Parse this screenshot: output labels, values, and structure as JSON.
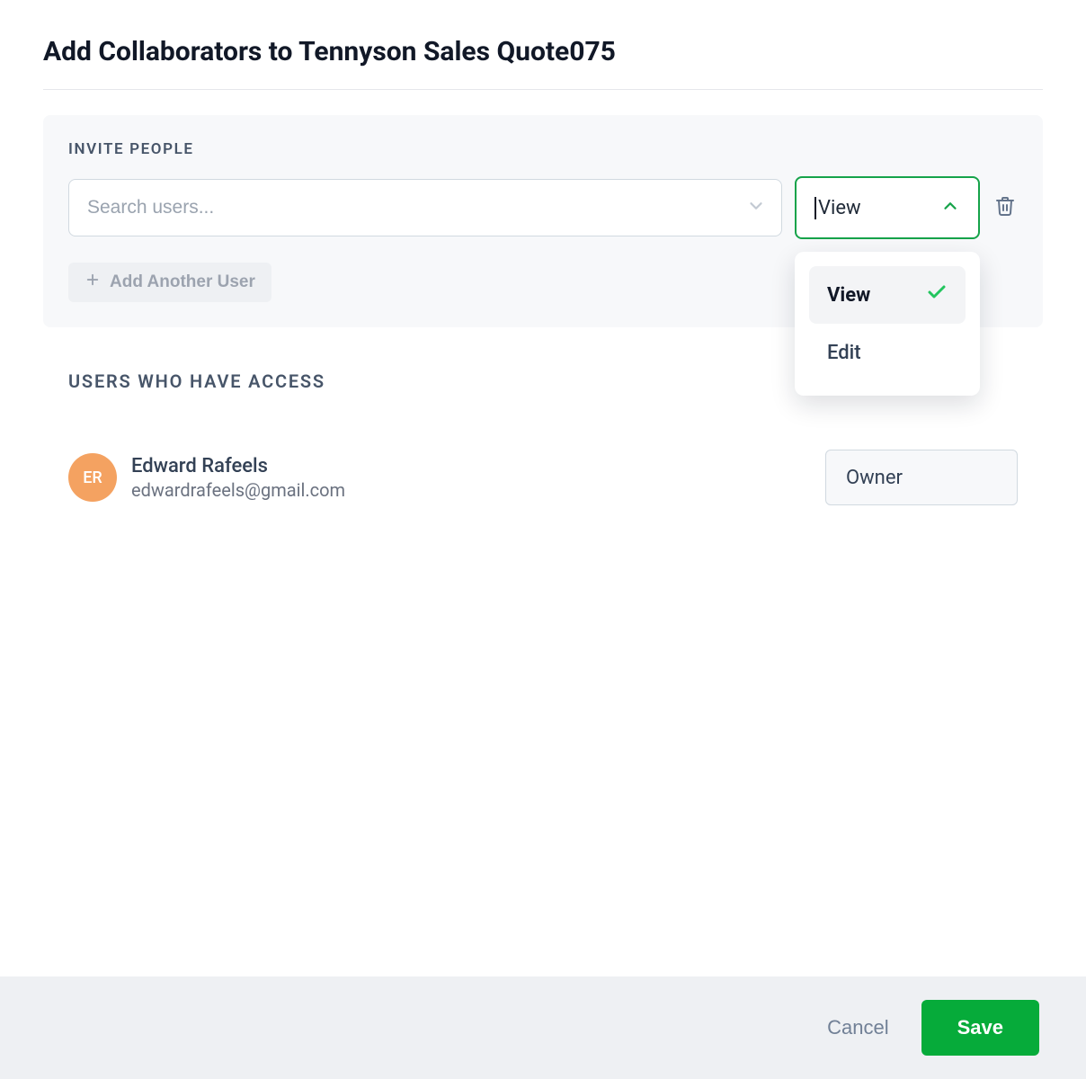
{
  "header": {
    "title": "Add Collaborators to Tennyson Sales Quote075"
  },
  "invite": {
    "section_label": "INVITE PEOPLE",
    "search_placeholder": "Search users...",
    "permission_selected": "View",
    "permission_options": [
      {
        "label": "View",
        "selected": true
      },
      {
        "label": "Edit",
        "selected": false
      }
    ],
    "add_another_label": "Add Another User"
  },
  "access": {
    "section_label": "USERS WHO HAVE ACCESS",
    "users": [
      {
        "initials": "ER",
        "name": "Edward Rafeels",
        "email": "edwardrafeels@gmail.com",
        "role": "Owner"
      }
    ]
  },
  "footer": {
    "cancel_label": "Cancel",
    "save_label": "Save"
  }
}
